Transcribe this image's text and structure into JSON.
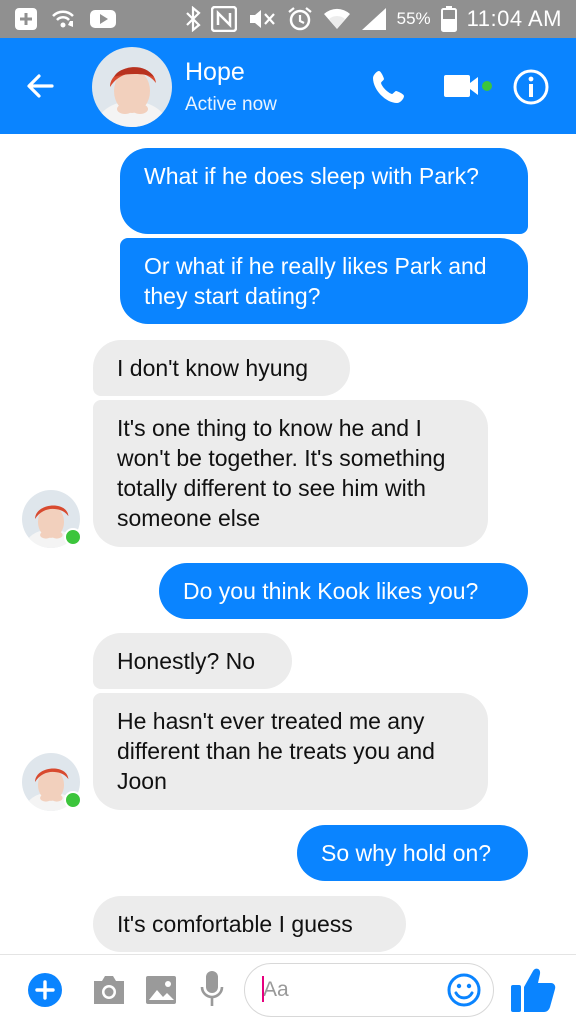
{
  "status_bar": {
    "battery": "55%",
    "time": "11:04 AM",
    "icons": [
      "add-icon",
      "wifi-calling-icon",
      "youtube-icon",
      "bluetooth-icon",
      "nfc-icon",
      "mute-icon",
      "alarm-icon",
      "wifi-icon",
      "signal-icon",
      "battery-icon"
    ]
  },
  "header": {
    "contact_name": "Hope",
    "contact_status": "Active now",
    "icons": [
      "back-arrow-icon",
      "phone-icon",
      "video-icon",
      "info-icon"
    ],
    "accent": "#0a84ff",
    "online_color": "#3cc53c"
  },
  "messages": [
    {
      "from": "me",
      "text": "What if he does sleep with Park?"
    },
    {
      "from": "me",
      "text": "Or what if he really likes Park and they start dating?"
    },
    {
      "from": "them",
      "text": "I don't know hyung"
    },
    {
      "from": "them",
      "text": "It's one thing to know he and I won't be together. It's something totally different to see him with someone else"
    },
    {
      "from": "me",
      "text": "Do you think Kook likes you?"
    },
    {
      "from": "them",
      "text": "Honestly? No"
    },
    {
      "from": "them",
      "text": "He hasn't ever treated me any different than he treats you and Joon"
    },
    {
      "from": "me",
      "text": "So why hold on?"
    },
    {
      "from": "them",
      "text": "It's comfortable I guess"
    }
  ],
  "composer": {
    "placeholder": "Aa",
    "icons": [
      "plus-icon",
      "camera-icon",
      "image-icon",
      "microphone-icon",
      "emoji-icon",
      "thumbs-up-icon"
    ]
  },
  "colors": {
    "outgoing_bubble": "#0a84ff",
    "incoming_bubble": "#ececec",
    "status_bar": "#909090"
  }
}
